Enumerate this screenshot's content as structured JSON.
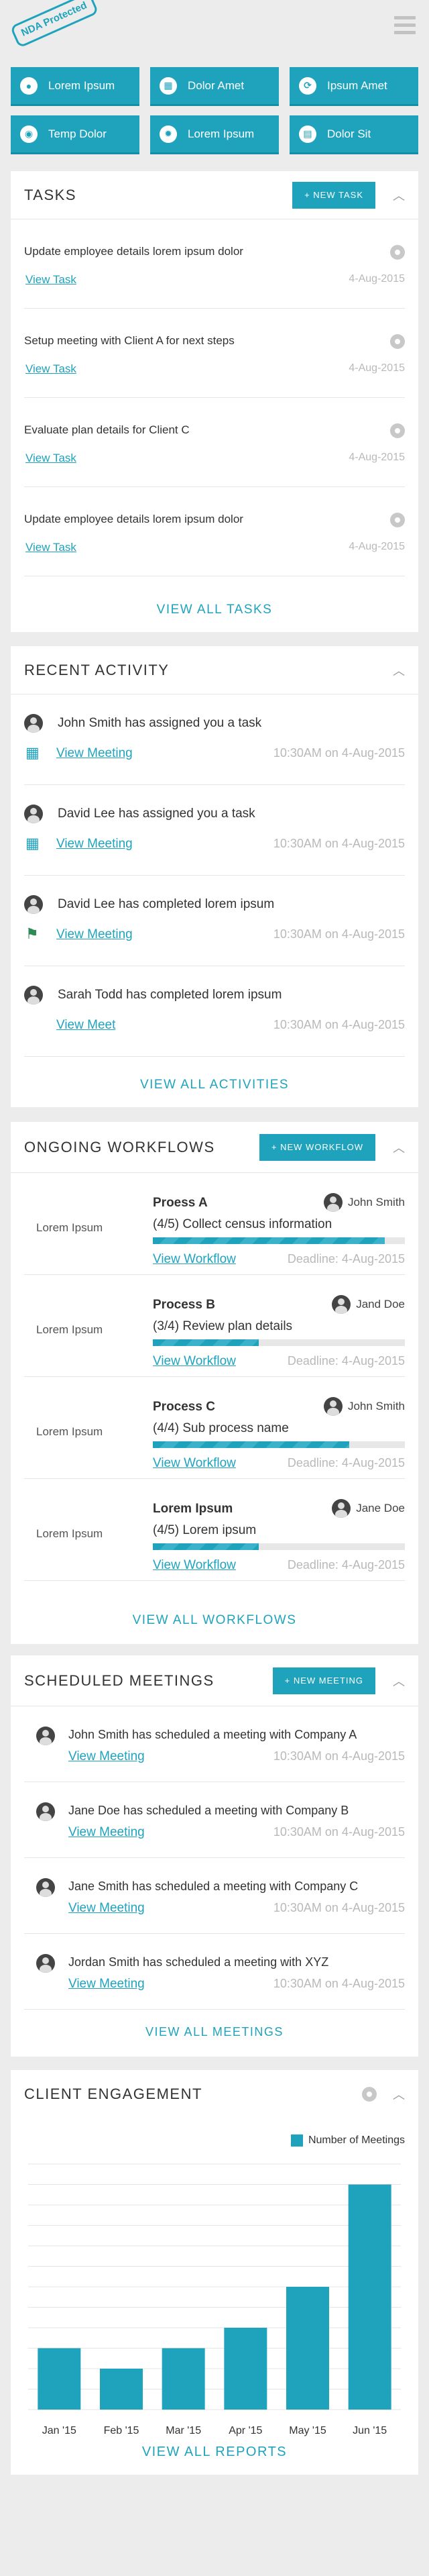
{
  "logo": {
    "text": "NDA Protected"
  },
  "tiles": [
    {
      "label": "Lorem Ipsum",
      "icon": "person-icon",
      "glyph": "●"
    },
    {
      "label": "Dolor Amet",
      "icon": "grid-icon",
      "glyph": "▦"
    },
    {
      "label": "Ipsum Amet",
      "icon": "sync-icon",
      "glyph": "⟳"
    },
    {
      "label": "Temp Dolor",
      "icon": "eye-icon",
      "glyph": "◉"
    },
    {
      "label": "Lorem Ipsum",
      "icon": "gear-icon",
      "glyph": "✹"
    },
    {
      "label": "Dolor Sit",
      "icon": "calculator-icon",
      "glyph": "▤"
    }
  ],
  "tasks": {
    "title": "TASKS",
    "new_button": "+ NEW TASK",
    "items": [
      {
        "text": "Update employee details lorem ipsum dolor",
        "link": "View Task",
        "date": "4-Aug-2015"
      },
      {
        "text": "Setup meeting with Client A for next steps",
        "link": "View Task",
        "date": "4-Aug-2015"
      },
      {
        "text": "Evaluate plan details for Client C",
        "link": "View Task",
        "date": "4-Aug-2015"
      },
      {
        "text": "Update employee details lorem ipsum dolor",
        "link": "View Task",
        "date": "4-Aug-2015"
      }
    ],
    "footer": "VIEW ALL TASKS"
  },
  "activity": {
    "title": "RECENT ACTIVITY",
    "items": [
      {
        "text": "John Smith has assigned you a task",
        "icon": "calendar-icon",
        "glyph": "▦",
        "link": "View Meeting",
        "time": "10:30AM on 4-Aug-2015"
      },
      {
        "text": "David Lee has assigned you a task",
        "icon": "calendar-icon",
        "glyph": "▦",
        "link": "View Meeting",
        "time": "10:30AM on 4-Aug-2015"
      },
      {
        "text": "David Lee has completed lorem ipsum",
        "icon": "flag-icon",
        "glyph": "⚑",
        "link": "View Meeting",
        "time": "10:30AM on 4-Aug-2015"
      },
      {
        "text": "Sarah Todd has completed lorem ipsum",
        "icon": "",
        "glyph": "",
        "link": "View Meet",
        "time": "10:30AM on 4-Aug-2015"
      }
    ],
    "footer": "VIEW ALL ACTIVITIES"
  },
  "workflows": {
    "title": "ONGOING WORKFLOWS",
    "new_button": "+ NEW WORKFLOW",
    "items": [
      {
        "label": "Lorem Ipsum",
        "process": "Proess A",
        "owner": "John Smith",
        "step": "(4/5) Collect census information",
        "progress": 0.92,
        "link": "View Workflow",
        "deadline": "Deadline: 4-Aug-2015"
      },
      {
        "label": "Lorem Ipsum",
        "process": "Process B",
        "owner": "Jand Doe",
        "step": "(3/4) Review plan details",
        "progress": 0.42,
        "link": "View Workflow",
        "deadline": "Deadline: 4-Aug-2015"
      },
      {
        "label": "Lorem Ipsum",
        "process": "Process C",
        "owner": "John Smith",
        "step": "(4/4) Sub process name",
        "progress": 0.78,
        "link": "View Workflow",
        "deadline": "Deadline: 4-Aug-2015"
      },
      {
        "label": "Lorem Ipsum",
        "process": "Lorem Ipsum",
        "owner": "Jane Doe",
        "step": "(4/5) Lorem ipsum",
        "progress": 0.42,
        "link": "View Workflow",
        "deadline": "Deadline: 4-Aug-2015"
      }
    ],
    "footer": "VIEW ALL WORKFLOWS"
  },
  "meetings": {
    "title": "SCHEDULED MEETINGS",
    "new_button": "+ NEW MEETING",
    "items": [
      {
        "text": "John Smith has scheduled a meeting with Company A",
        "link": "View Meeting",
        "time": "10:30AM on 4-Aug-2015"
      },
      {
        "text": "Jane Doe has scheduled a meeting with Company B",
        "link": "View Meeting",
        "time": "10:30AM on 4-Aug-2015"
      },
      {
        "text": "Jane Smith has scheduled a meeting with Company C",
        "link": "View Meeting",
        "time": "10:30AM on 4-Aug-2015"
      },
      {
        "text": "Jordan Smith has scheduled a meeting with XYZ",
        "link": "View Meeting",
        "time": "10:30AM on 4-Aug-2015"
      }
    ],
    "footer": "VIEW ALL MEETINGS"
  },
  "engagement": {
    "title": "CLIENT ENGAGEMENT",
    "footer": "VIEW ALL REPORTS"
  },
  "chart_data": {
    "type": "bar",
    "categories": [
      "Jan '15",
      "Feb '15",
      "Mar '15",
      "Apr '15",
      "May '15",
      "Jun '15"
    ],
    "series": [
      {
        "name": "Number of Meetings",
        "values": [
          3,
          2,
          3,
          4,
          6,
          11
        ]
      }
    ],
    "ylim": [
      0,
      12
    ],
    "grid": true,
    "legend": "top-right",
    "color": "#1fa3bd"
  }
}
